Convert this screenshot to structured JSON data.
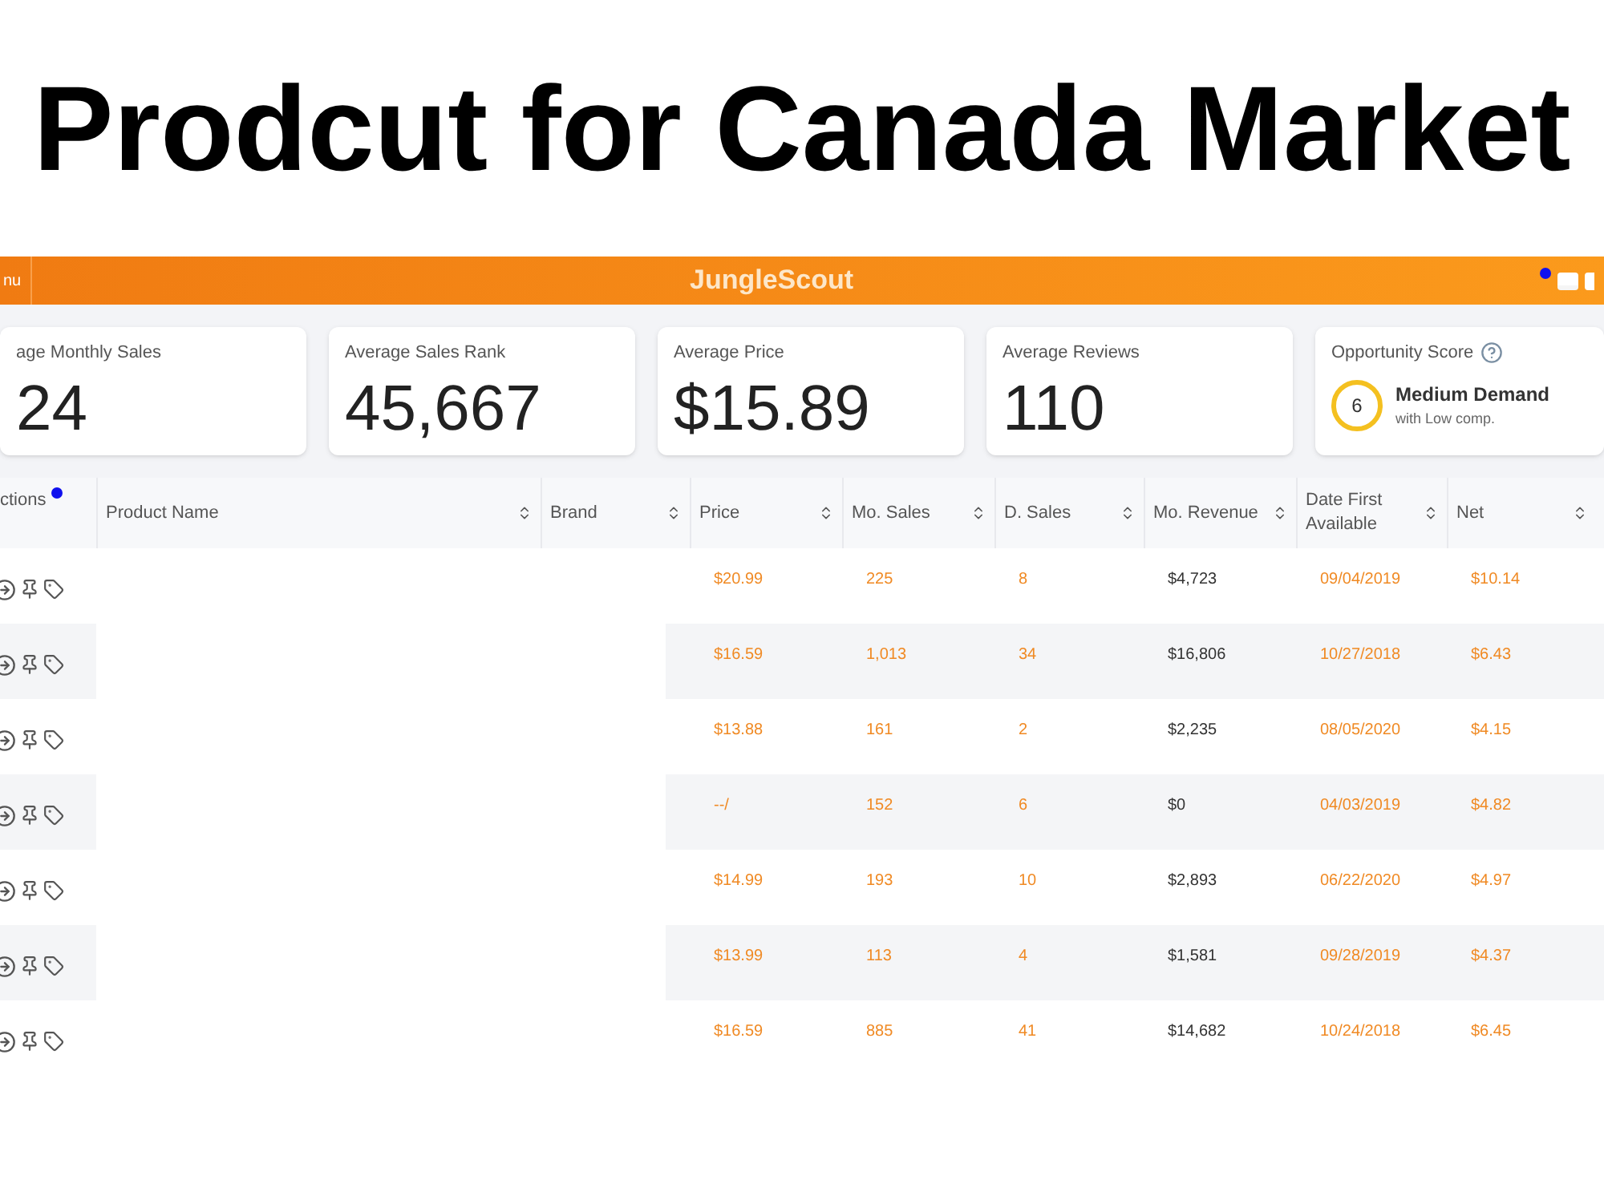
{
  "headline": "Prodcut for Canada Market",
  "app_bar": {
    "menu": "nu",
    "brand": "JungleScout",
    "notification": true
  },
  "stats": [
    {
      "kind": "number",
      "label": "age Monthly Sales",
      "value": "24"
    },
    {
      "kind": "number",
      "label": "Average Sales Rank",
      "value": "45,667"
    },
    {
      "kind": "number",
      "label": "Average Price",
      "value": "$15.89"
    },
    {
      "kind": "number",
      "label": "Average Reviews",
      "value": "110"
    },
    {
      "kind": "score",
      "label": "Opportunity Score",
      "value": "6",
      "title": "Medium Demand",
      "subtitle": "with Low comp."
    }
  ],
  "table": {
    "actions_header": "ctions",
    "actions_dot": true,
    "columns": [
      {
        "label": "Product Name"
      },
      {
        "label": "Brand"
      },
      {
        "label": "Price"
      },
      {
        "label": "Mo. Sales"
      },
      {
        "label": "D. Sales"
      },
      {
        "label": "Mo. Revenue"
      },
      {
        "label": "Date First Available"
      },
      {
        "label": "Net"
      }
    ],
    "rows": [
      {
        "price": "$20.99",
        "mo_sales": "225",
        "d_sales": "8",
        "revenue": "$4,723",
        "date": "09/04/2019",
        "net": "$10.14"
      },
      {
        "price": "$16.59",
        "mo_sales": "1,013",
        "d_sales": "34",
        "revenue": "$16,806",
        "date": "10/27/2018",
        "net": "$6.43"
      },
      {
        "price": "$13.88",
        "mo_sales": "161",
        "d_sales": "2",
        "revenue": "$2,235",
        "date": "08/05/2020",
        "net": "$4.15"
      },
      {
        "price": "--/",
        "mo_sales": "152",
        "d_sales": "6",
        "revenue": "$0",
        "date": "04/03/2019",
        "net": "$4.82"
      },
      {
        "price": "$14.99",
        "mo_sales": "193",
        "d_sales": "10",
        "revenue": "$2,893",
        "date": "06/22/2020",
        "net": "$4.97"
      },
      {
        "price": "$13.99",
        "mo_sales": "113",
        "d_sales": "4",
        "revenue": "$1,581",
        "date": "09/28/2019",
        "net": "$4.37"
      },
      {
        "price": "$16.59",
        "mo_sales": "885",
        "d_sales": "41",
        "revenue": "$14,682",
        "date": "10/24/2018",
        "net": "$6.45"
      }
    ]
  }
}
